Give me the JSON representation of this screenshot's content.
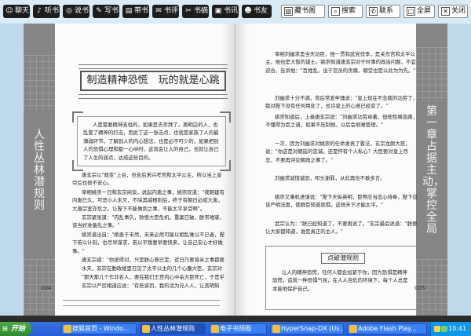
{
  "toolbar": {
    "buttons": [
      {
        "label": "聊天",
        "icon": "chat-icon",
        "glyph": "☺"
      },
      {
        "label": "听书",
        "icon": "headphone-icon",
        "glyph": "♪"
      },
      {
        "label": "说书",
        "icon": "microphone-icon",
        "glyph": "◎"
      },
      {
        "label": "写书",
        "icon": "pen-icon",
        "glyph": "✎"
      },
      {
        "label": "带书",
        "icon": "book-icon",
        "glyph": "▤"
      },
      {
        "label": "书评",
        "icon": "comment-icon",
        "glyph": "✉"
      },
      {
        "label": "书摘",
        "icon": "excerpt-icon",
        "glyph": "✂"
      },
      {
        "label": "书讯",
        "icon": "news-icon",
        "glyph": "▣"
      },
      {
        "label": "书友",
        "icon": "friends-icon",
        "glyph": "☻"
      }
    ],
    "right_buttons": [
      {
        "label": "藏书阁",
        "icon": "bookshelf-icon",
        "glyph": "▥"
      },
      {
        "label": "搜索",
        "icon": "search-icon",
        "glyph": "⌕"
      },
      {
        "label": "联系",
        "icon": "contact-icon",
        "glyph": "✆"
      },
      {
        "label": "全屏",
        "icon": "fullscreen-icon",
        "glyph": "□"
      },
      {
        "label": "关闭",
        "icon": "close-icon",
        "glyph": "✕"
      }
    ]
  },
  "book": {
    "left_band_title": "人性丛林潜规则",
    "right_band_title": "第一章　占据主动，掌控全局",
    "left_title": "制造精神恐慌　玩的就是心跳",
    "left_intro": "人是需要精神支柱的，如果是去崇拜了，再明白的人，也乱套了精神的打击，因此丁这一张击点，也就是家族了人的最薄弱环节，了解到人的内心想法，也是必不可少的，如果把别人的恐惧心理和都一心中时，这就会让人的自己，也就让自己了人生的弱点，达成这些目的。",
    "left_paragraphs": [
      "唐玄宗以\"政变\"上台，也告后来兴考宫和太平公主，所以当上皇帝后也很不安心。",
      "宰相姚崇一日和玄宗闲谈，说起内患之事，姚崇叹道：\"我朝建有内患已久，可恶小人未灭，不除其威根则后，终于有朝日必成大患，大唐宗室亦危之，让陛下不能做到之事，不能太平享受啊\"。",
      "玄宗紧张道：\"内乱事久，败恨大臣危机，重案已破，朕常难寐，该当好准备乱之事。\"",
      "姚崇道出自：\"绝患于未然，未来必然可能以相乱难以不已者，陛下若以计刻，也尽早谋求，若以平叛要早要快来，让自己安心才好做事。\"",
      "唐玄宗道：\"你说得对，只是朕心意已定，近日乃要将亲之事都要在政中消灭了。\"",
      "水天，玄宗在勤政楼里召见了太平公主的几个心腹大臣，玄宗对他们说了很长的一番话，那几个大臣都大惊失色，不敢正视。",
      "\"那天那几个作非名人，要在我们王宫内心中杀大臣死亡，于是乎你们有何话说？\"",
      "玄宗以严厉相道应说：\"有些该罚，我的话为兄人人，让其明知意。\""
    ],
    "left_page_num": "004",
    "right_paragraphs": [
      "宰相刘幽求是当天功臣，他一贯和武党伐争，是关东宫和太平公主，他也是大智的谋士。姚崇知道唐玄宗对于时事的政治问题，不宜迎合，告诉他：\"百姓乱，出于官员的贪腐，朝堂也是以此为为先。\"",
      "刘幽求十分不满，背后常发牢骚说：\"皇上现在不念我的功劳了，我对陛下没有任何用处了，也许皇上的心意已经变了。\"",
      "姚崇知道后，上奏唐玄宗说：\"刘幽求功劳卓著，但他性格急躁，不懂得为臣之道，如果不压制他，以后会很难管理。\"",
      "一次，因为刘幽求对姚崇的任命发表了看法，玄宗龙颜大怒，说：\"你这是对朝廷的忠诚，还是怀有个人私心？大臣要对皇上尽忠，不要再评论朝政之事了。\"",
      "刘幽求诚惶诚恐，叩头谢罪，从此再也不敢多言。",
      "姚崇又乘机进谏说：\"陛下天纵英明，臣等应当忠心侍奉，陛下应该严明法度，使群臣知道畏惧，这样天下才能太平。\"",
      "武宗认为：\"朕已经知道了，不要再说了。\"玄宗最后说道：\"朕要让大家都知道，谁是真正的主人。\""
    ],
    "right_box_title": "点破潜规则",
    "right_box_text": "让人的精神恐慌，任何人都会加紧于你，因为恐惧是精神恐慌，造就一种恐惧气氛，在人人自危的环境下，每个人总是本能地保护自己。",
    "right_page_num": "005"
  },
  "taskbar": {
    "start_label": "开始",
    "tasks": [
      {
        "label": "搜狐首页 - Windo..."
      },
      {
        "label": "人性丛林潜规则"
      },
      {
        "label": "电子书预图"
      },
      {
        "label": "HyperSnap-DX (Us..."
      },
      {
        "label": "Adobe Flash Play..."
      }
    ],
    "clock": "10:41"
  },
  "colors": {
    "band": "#868686",
    "toolbar_button": "#1d1d1d",
    "taskbar": "#245edb",
    "start": "#2f8a2f",
    "tray": "#0f97e8"
  }
}
